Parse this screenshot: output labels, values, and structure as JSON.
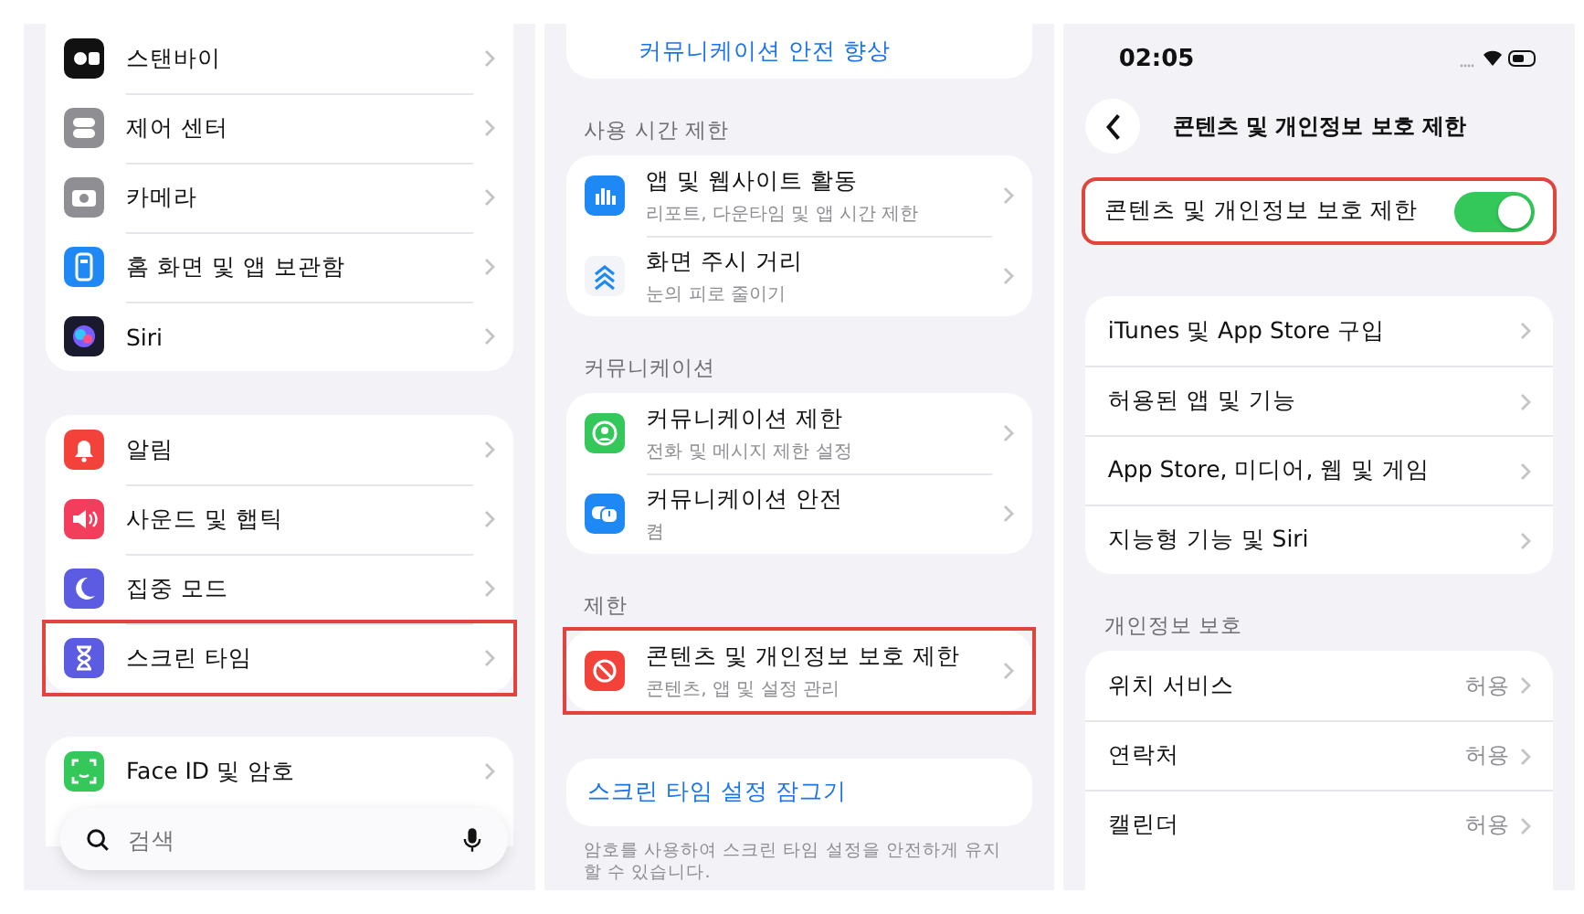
{
  "settings_list": {
    "groups": [
      {
        "items": [
          {
            "label": "스탠바이",
            "highlighted": false
          },
          {
            "label": "제어 센터",
            "highlighted": false
          },
          {
            "label": "카메라",
            "highlighted": false
          },
          {
            "label": "홈 화면 및 앱 보관함",
            "highlighted": false
          },
          {
            "label": "Siri",
            "highlighted": false
          }
        ]
      },
      {
        "items": [
          {
            "label": "알림",
            "highlighted": false
          },
          {
            "label": "사운드 및 햅틱",
            "highlighted": false
          },
          {
            "label": "집중 모드",
            "highlighted": false
          },
          {
            "label": "스크린 타임",
            "highlighted": true
          }
        ]
      },
      {
        "items": [
          {
            "label": "Face ID 및 암호",
            "highlighted": false
          }
        ]
      }
    ],
    "search": {
      "placeholder": "검색"
    }
  },
  "screen_time": {
    "top_link": "커뮤니케이션 안전 향상",
    "sections": [
      {
        "header": "사용 시간 제한",
        "items": [
          {
            "title": "앱 및 웹사이트 활동",
            "subtitle": "리포트, 다운타임 및 앱 시간 제한",
            "highlighted": false
          },
          {
            "title": "화면 주시 거리",
            "subtitle": "눈의 피로 줄이기",
            "highlighted": false
          }
        ]
      },
      {
        "header": "커뮤니케이션",
        "items": [
          {
            "title": "커뮤니케이션 제한",
            "subtitle": "전화 및 메시지 제한 설정",
            "highlighted": false
          },
          {
            "title": "커뮤니케이션 안전",
            "subtitle": "켬",
            "highlighted": false
          }
        ]
      },
      {
        "header": "제한",
        "items": [
          {
            "title": "콘텐츠 및 개인정보 보호 제한",
            "subtitle": "콘텐츠, 앱 및 설정 관리",
            "highlighted": true
          }
        ]
      }
    ],
    "lock_link": "스크린 타임 설정 잠그기",
    "footer": "암호를 사용하여 스크린 타임 설정을 안전하게 유지할 수 있습니다."
  },
  "content_restrictions": {
    "time": "02:05",
    "title": "콘텐츠 및 개인정보 보호 제한",
    "toggle": {
      "label": "콘텐츠 및 개인정보 보호 제한",
      "on": true,
      "highlighted": true
    },
    "items": [
      {
        "label": "iTunes 및 App Store 구입"
      },
      {
        "label": "허용된 앱 및 기능"
      },
      {
        "label": "App Store, 미디어, 웹 및 게임"
      },
      {
        "label": "지능형 기능 및 Siri"
      }
    ],
    "privacy_header": "개인정보 보호",
    "privacy_items": [
      {
        "label": "위치 서비스",
        "value": "허용"
      },
      {
        "label": "연락처",
        "value": "허용"
      },
      {
        "label": "캘린더",
        "value": "허용"
      }
    ]
  }
}
